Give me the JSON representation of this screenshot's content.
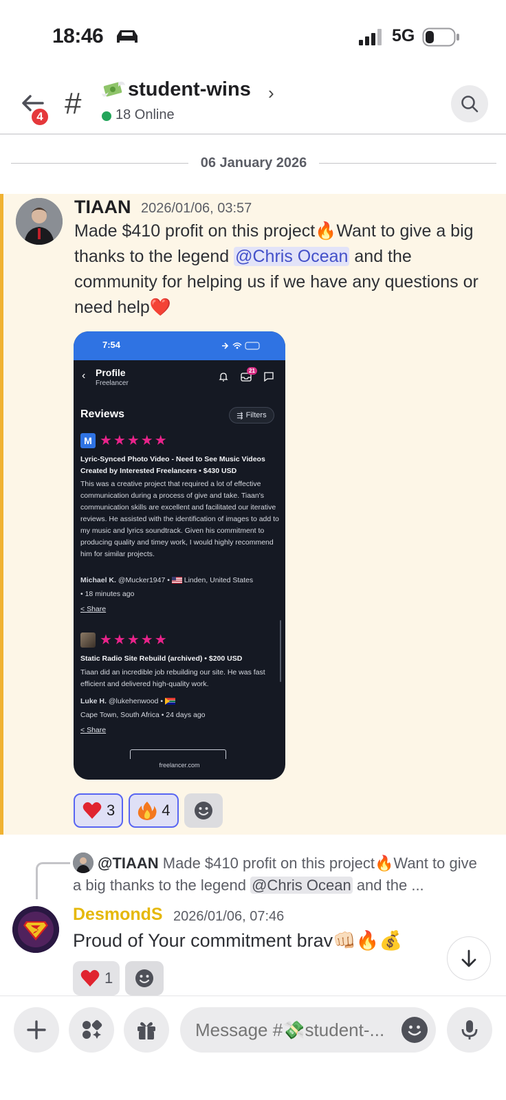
{
  "status_bar": {
    "time": "18:46",
    "network": "5G"
  },
  "header": {
    "back_badge": "4",
    "channel_name": "student-wins",
    "online": "18 Online"
  },
  "date_divider": "06 January 2026",
  "message1": {
    "author": "TIAAN",
    "timestamp": "2026/01/06, 03:57",
    "text_part1": "Made $410 profit on this project",
    "text_part2": "Want to give a big thanks to the legend ",
    "mention": "@Chris Ocean",
    "text_part3": " and the community for helping us if we have any questions or need help",
    "embed": {
      "time": "7:54",
      "nav_title": "Profile",
      "nav_subtitle": "Freelancer",
      "inbox_badge": "21",
      "section_title": "Reviews",
      "filters_label": "Filters",
      "reviews": [
        {
          "badge": "M",
          "stars": "★★★★★",
          "title": "Lyric-Synced Photo Video - Need to See Music Videos Created by Interested Freelancers • $430 USD",
          "text": "This was a creative project that required a lot of effective communication during a process of give and take. Tiaan's communication skills are excellent and facilitated our iterative reviews. He assisted with the identification of images to add to my music and lyrics soundtrack. Given his commitment to producing quality and timey work, I would highly recommend him for similar projects.",
          "reviewer": "Michael K.",
          "handle": "@Mucker1947 •",
          "location": "Linden, United States",
          "ago": "• 18 minutes ago",
          "share": "Share"
        },
        {
          "stars": "★★★★★",
          "title": "Static Radio Site Rebuild (archived) • $200 USD",
          "text": "Tiaan did an incredible job rebuilding our site. He was fast efficient and delivered high-quality work.",
          "reviewer": "Luke H.",
          "handle": "@lukehenwood •",
          "location": "Cape Town, South Africa • 24 days ago",
          "share": "Share"
        }
      ],
      "footer_url": "freelancer.com"
    },
    "reactions": [
      {
        "emoji": "heart",
        "count": "3"
      },
      {
        "emoji": "fire",
        "count": "4"
      }
    ]
  },
  "message2": {
    "reply_author": "@TIAAN",
    "reply_text_a": " Made $410 profit on this project",
    "reply_text_b": "Want to give a big thanks to the legend ",
    "reply_mention": "@Chris Ocean",
    "reply_text_c": " and the ...",
    "author": "DesmondS",
    "timestamp": "2026/01/06, 07:46",
    "text": "Proud of Your commitment brav",
    "reactions": [
      {
        "emoji": "heart",
        "count": "1"
      }
    ]
  },
  "composer": {
    "placeholder": "Message #💸student-..."
  },
  "colors": {
    "accent": "#5865f2",
    "highlight_bg": "#fdf6e7",
    "highlight_bar": "#f0b232",
    "desmond_name": "#e5b80b",
    "online": "#23a55a",
    "star": "#e8238a"
  }
}
